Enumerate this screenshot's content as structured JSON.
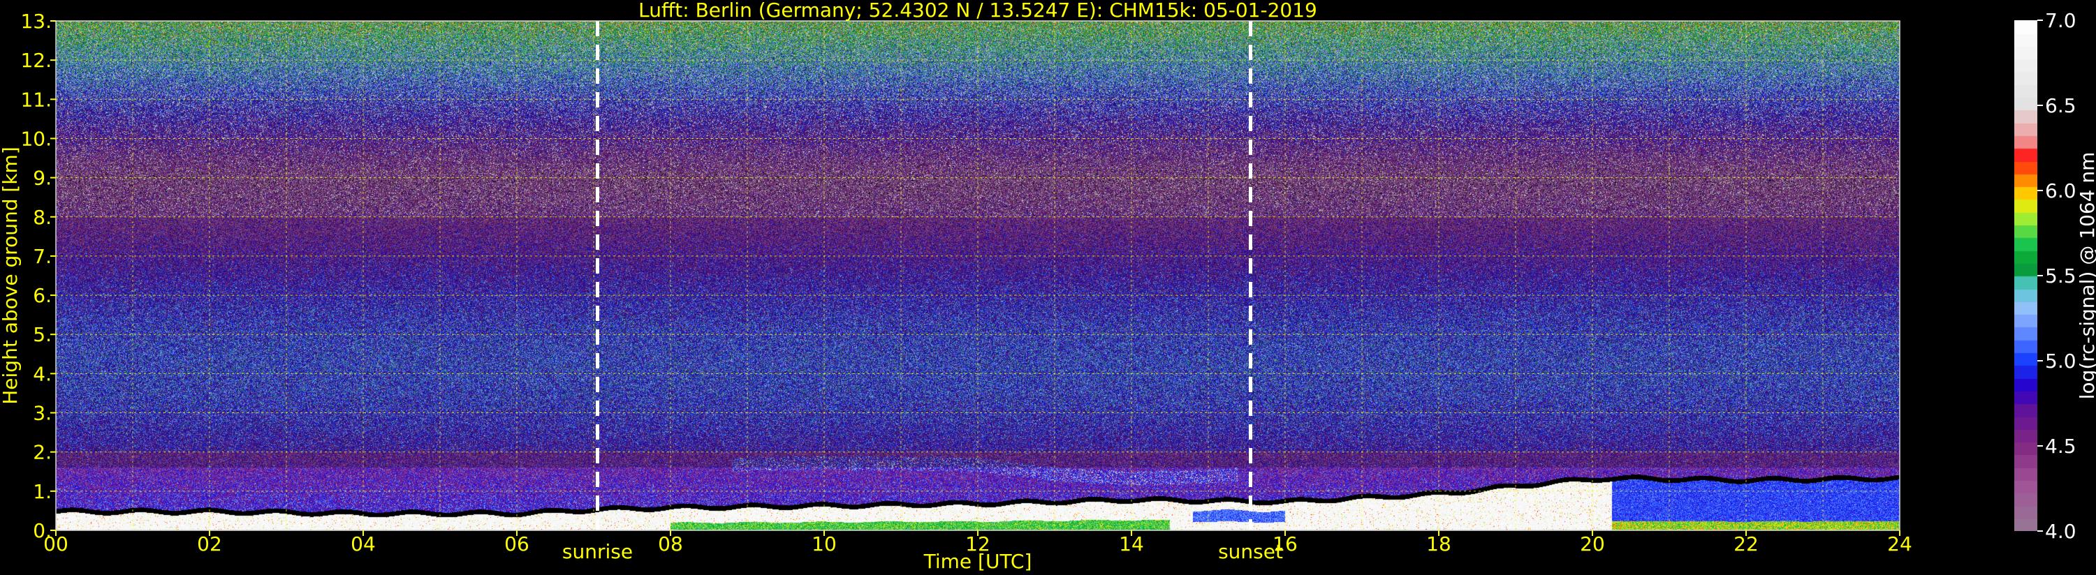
{
  "chart_data": {
    "type": "heatmap",
    "title": "Lufft: Berlin (Germany; 52.4302 N / 13.5247 E):    CHM15k: 05-01-2019",
    "xlabel": "Time [UTC]",
    "ylabel": "Height above ground [km]",
    "xlim": [
      0,
      24
    ],
    "ylim": [
      0,
      13
    ],
    "x_ticks": [
      "00",
      "02",
      "04",
      "06",
      "08",
      "10",
      "12",
      "14",
      "16",
      "18",
      "20",
      "22",
      "24"
    ],
    "y_ticks": [
      "0.",
      "1.",
      "2.",
      "3.",
      "4.",
      "5.",
      "6.",
      "7.",
      "8.",
      "9.",
      "10.",
      "11.",
      "12.",
      "13."
    ],
    "grid": true,
    "annotations": [
      {
        "label": "sunrise",
        "x": 7.05
      },
      {
        "label": "sunset",
        "x": 15.55
      }
    ],
    "colorbar": {
      "label": "log(rc-signal) @ 1064 nm",
      "range": [
        4.0,
        7.0
      ],
      "ticks": [
        "4.0",
        "4.5",
        "5.0",
        "5.5",
        "6.0",
        "6.5",
        "7.0"
      ]
    },
    "layers": [
      {
        "feature": "surface aerosol layer top",
        "x": [
          0,
          2,
          4,
          6,
          7,
          8,
          10,
          12,
          14,
          16,
          18,
          19.5,
          20.2,
          22,
          24
        ],
        "top_km": [
          0.45,
          0.45,
          0.4,
          0.4,
          0.5,
          0.55,
          0.6,
          0.65,
          0.75,
          0.7,
          0.9,
          1.2,
          1.3,
          1.25,
          1.3
        ]
      },
      {
        "feature": "elevated aerosol/cloud layer",
        "x": [
          8.8,
          10,
          12,
          13,
          14,
          15,
          15.4
        ],
        "top_km": [
          1.85,
          1.9,
          1.85,
          1.6,
          1.5,
          1.55,
          1.6
        ]
      },
      {
        "feature": "enhanced backscatter layer (blue)",
        "x": [
          20.2,
          22,
          24
        ],
        "top_km": [
          1.3,
          1.25,
          1.3
        ],
        "value": 5.0
      }
    ]
  }
}
